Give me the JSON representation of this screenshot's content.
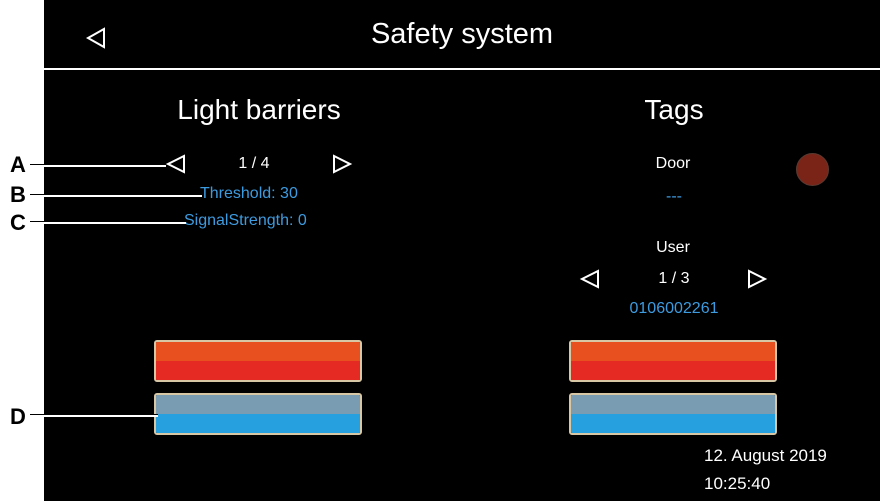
{
  "header": {
    "title": "Safety system"
  },
  "light_barriers": {
    "title": "Light barriers",
    "pager": "1 / 4",
    "threshold": "Threshold: 30",
    "signal_strength": "SignalStrength: 0"
  },
  "tags": {
    "title": "Tags",
    "door_label": "Door",
    "door_value": "---",
    "user_label": "User",
    "user_pager": "1 / 3",
    "user_id": "0106002261"
  },
  "colors": {
    "red_top": "#e8501f",
    "red_bottom": "#e42a23",
    "blue_top": "#7a9cb2",
    "blue_bottom": "#27a0df",
    "status_dot": "#7a2418",
    "accent_text": "#3d9be0"
  },
  "footer": {
    "date": "12. August 2019",
    "time": "10:25:40"
  },
  "callouts": {
    "a": "A",
    "b": "B",
    "c": "C",
    "d": "D"
  }
}
